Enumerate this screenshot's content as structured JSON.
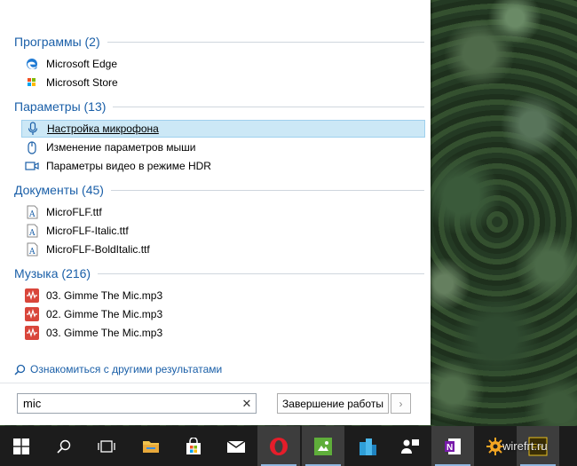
{
  "search_results": {
    "sections": [
      {
        "header": "Программы (2)",
        "items": [
          {
            "label": "Microsoft Edge",
            "icon": "edge-icon"
          },
          {
            "label": "Microsoft Store",
            "icon": "store-icon"
          }
        ]
      },
      {
        "header": "Параметры (13)",
        "items": [
          {
            "label": "Настройка микрофона",
            "icon": "microphone-icon",
            "selected": true
          },
          {
            "label": "Изменение параметров мыши",
            "icon": "mouse-icon"
          },
          {
            "label": "Параметры видео в режиме HDR",
            "icon": "video-icon"
          }
        ]
      },
      {
        "header": "Документы (45)",
        "items": [
          {
            "label": "MicroFLF.ttf",
            "icon": "font-file-icon"
          },
          {
            "label": "MicroFLF-Italic.ttf",
            "icon": "font-file-icon"
          },
          {
            "label": "MicroFLF-BoldItalic.ttf",
            "icon": "font-file-icon"
          }
        ]
      },
      {
        "header": "Музыка (216)",
        "items": [
          {
            "label": "03. Gimme The Mic.mp3",
            "icon": "audio-file-icon"
          },
          {
            "label": "02. Gimme The Mic.mp3",
            "icon": "audio-file-icon"
          },
          {
            "label": "03. Gimme The Mic.mp3",
            "icon": "audio-file-icon"
          }
        ]
      }
    ],
    "more_results_link": "Ознакомиться с другими результатами"
  },
  "search": {
    "value": "mic",
    "clear_icon": "close-icon"
  },
  "shutdown": {
    "label": "Завершение работы",
    "arrow_icon": "chevron-right-icon"
  },
  "taskbar": {
    "icons": [
      "windows-start-icon",
      "search-icon",
      "task-view-icon",
      "file-explorer-icon",
      "store-icon",
      "mail-icon",
      "opera-icon",
      "app-icon",
      "buildings-icon",
      "people-icon",
      "onenote-icon",
      "settings-app-icon",
      "fireworks-icon"
    ]
  },
  "watermark": "wirefrt.ru",
  "colors": {
    "accent": "#1a5fa8",
    "selection": "#cce8f6",
    "taskbar": "#1c1c1c"
  }
}
